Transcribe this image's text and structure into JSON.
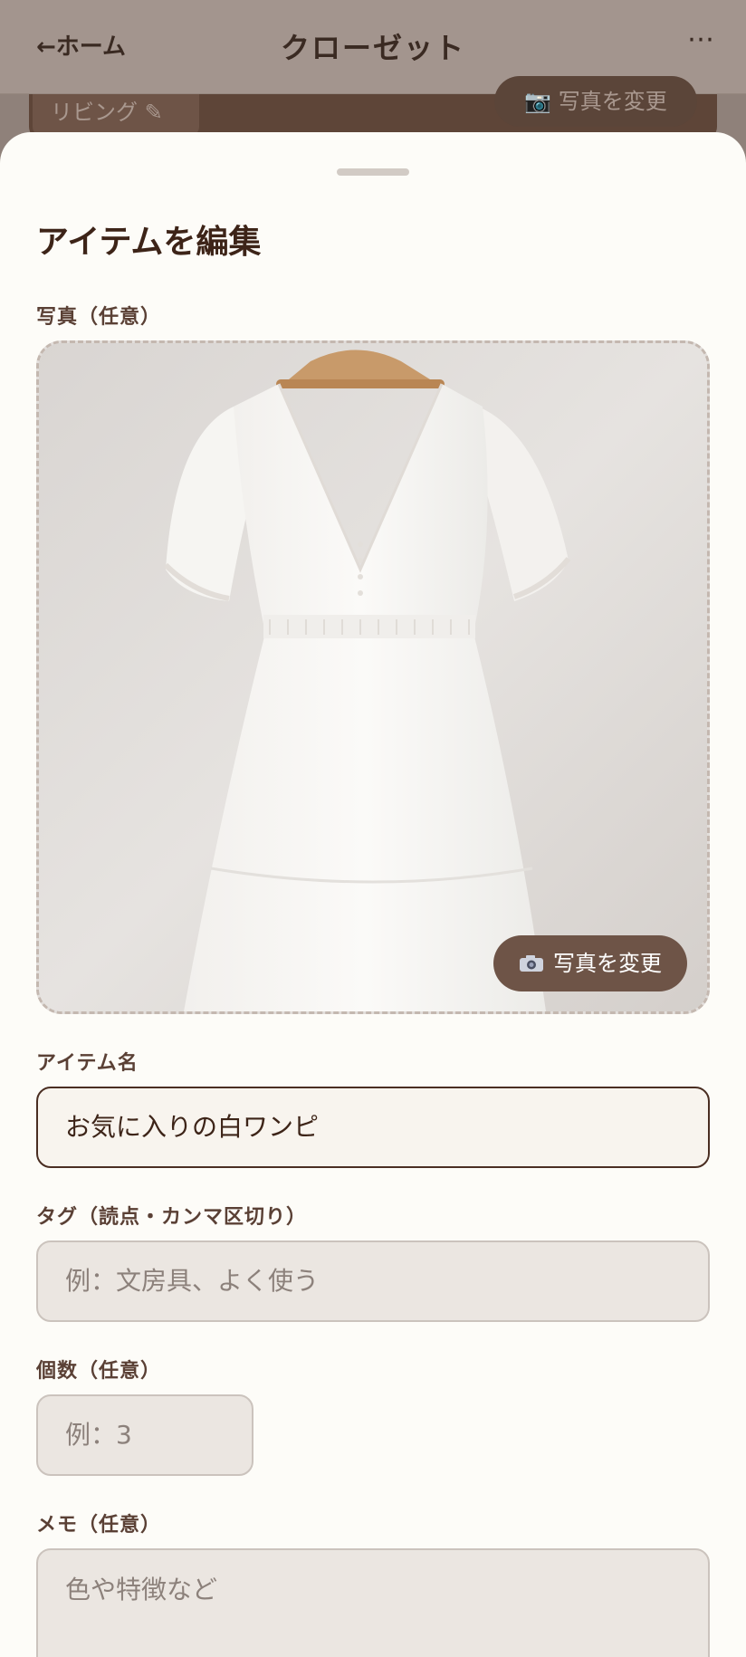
{
  "header": {
    "back_label": "←ホーム",
    "title": "クローゼット",
    "more_label": "⋯"
  },
  "background": {
    "room_label": "リビング ✎",
    "change_photo_label": "📷 写真を変更"
  },
  "sheet": {
    "title": "アイテムを編集",
    "photo": {
      "label": "写真（任意）",
      "image_icon": "white-dress-photo",
      "change_button_label": "写真を変更",
      "change_button_icon": "camera-icon"
    },
    "name": {
      "label": "アイテム名",
      "value": "お気に入りの白ワンピ"
    },
    "tags": {
      "label": "タグ（読点・カンマ区切り）",
      "placeholder": "例：文房具、よく使う"
    },
    "count": {
      "label": "個数（任意）",
      "placeholder": "例：3"
    },
    "memo": {
      "label": "メモ（任意）",
      "placeholder": "色や特徴など"
    }
  },
  "colors": {
    "header_dim": "#a3958e",
    "sheet_bg": "#fdfcf8",
    "accent_brown": "#6e5447",
    "title_text": "#3d2418"
  }
}
